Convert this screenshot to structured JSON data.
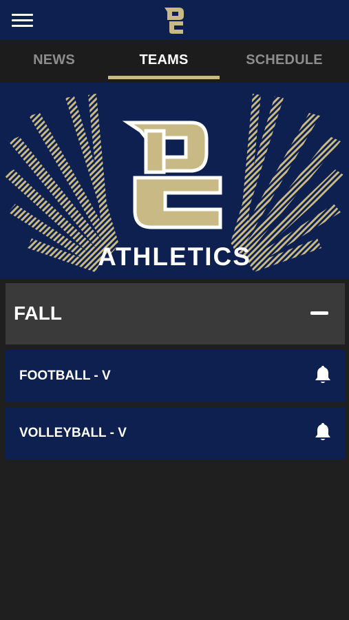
{
  "header": {
    "menu_icon": "hamburger-menu-icon",
    "logo": "DC"
  },
  "tabs": [
    {
      "label": "NEWS",
      "active": false
    },
    {
      "label": "TEAMS",
      "active": true
    },
    {
      "label": "SCHEDULE",
      "active": false
    }
  ],
  "banner": {
    "logo_text": "DC",
    "title": "ATHLETICS"
  },
  "section": {
    "title": "FALL",
    "toggle_icon": "minus-icon",
    "teams": [
      {
        "name": "FOOTBALL - V",
        "icon": "bell-icon"
      },
      {
        "name": "VOLLEYBALL - V",
        "icon": "bell-icon"
      }
    ]
  },
  "colors": {
    "navy": "#0e2050",
    "gold": "#c8b985",
    "dark_background": "#1f1f1f",
    "section_background": "#3a3a3a"
  }
}
